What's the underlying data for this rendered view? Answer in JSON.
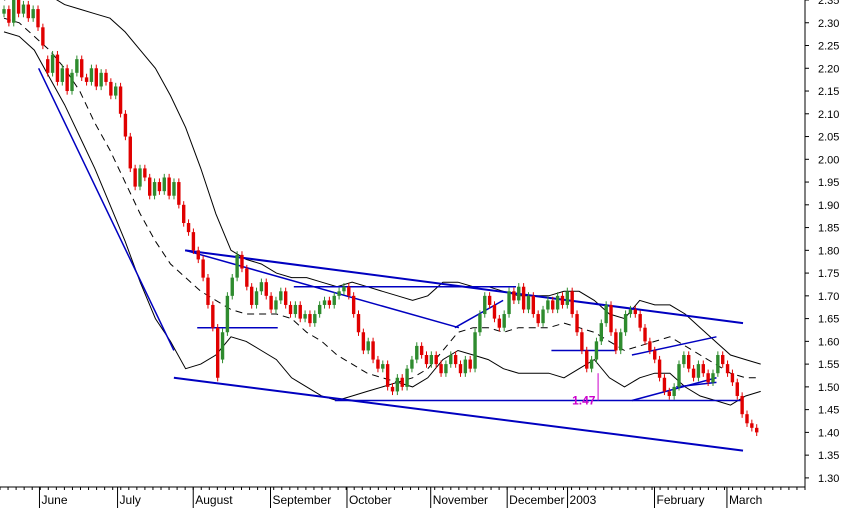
{
  "chart_data": {
    "type": "candlestick",
    "y_axis": {
      "ylim": [
        1.28,
        2.35
      ],
      "ticks": [
        "1.30",
        "1.35",
        "1.40",
        "1.45",
        "1.50",
        "1.55",
        "1.60",
        "1.65",
        "1.70",
        "1.75",
        "1.80",
        "1.85",
        "1.90",
        "1.95",
        "2.00",
        "2.05",
        "2.10",
        "2.15",
        "2.20",
        "2.25",
        "2.30",
        "2.35"
      ]
    },
    "x_axis": {
      "xlim": [
        0,
        100
      ],
      "labels": [
        {
          "text": "June",
          "x": 5.4
        },
        {
          "text": "July",
          "x": 15.1
        },
        {
          "text": "August",
          "x": 24.5
        },
        {
          "text": "September",
          "x": 34.1
        },
        {
          "text": "October",
          "x": 43.6
        },
        {
          "text": "November",
          "x": 54.0
        },
        {
          "text": "December",
          "x": 63.5
        },
        {
          "text": "2003",
          "x": 71.0
        },
        {
          "text": "February",
          "x": 81.8
        },
        {
          "text": "March",
          "x": 90.8
        }
      ]
    },
    "grid": false,
    "colors": {
      "up": "#2e8b2e",
      "down": "#e00000",
      "trendline": "#0000c0",
      "bands": "#000000",
      "annotation": "#cc00cc",
      "frame": "#000000"
    },
    "prices": [
      [
        2.32,
        2.33
      ],
      [
        2.33,
        2.3
      ],
      [
        2.3,
        2.35
      ],
      [
        2.35,
        2.32
      ],
      [
        2.32,
        2.34
      ],
      [
        2.34,
        2.31
      ],
      [
        2.31,
        2.33
      ],
      [
        2.33,
        2.29
      ],
      [
        2.29,
        2.25
      ],
      [
        2.22,
        2.19
      ],
      [
        2.19,
        2.23
      ],
      [
        2.23,
        2.17
      ],
      [
        2.17,
        2.2
      ],
      [
        2.2,
        2.15
      ],
      [
        2.15,
        2.19
      ],
      [
        2.19,
        2.22
      ],
      [
        2.22,
        2.18
      ],
      [
        2.18,
        2.17
      ],
      [
        2.17,
        2.2
      ],
      [
        2.2,
        2.16
      ],
      [
        2.16,
        2.19
      ],
      [
        2.19,
        2.17
      ],
      [
        2.17,
        2.14
      ],
      [
        2.14,
        2.16
      ],
      [
        2.16,
        2.1
      ],
      [
        2.1,
        2.05
      ],
      [
        2.05,
        1.98
      ],
      [
        1.98,
        1.94
      ],
      [
        1.94,
        1.98
      ],
      [
        1.98,
        1.96
      ],
      [
        1.96,
        1.92
      ],
      [
        1.92,
        1.95
      ],
      [
        1.95,
        1.93
      ],
      [
        1.93,
        1.96
      ],
      [
        1.96,
        1.92
      ],
      [
        1.92,
        1.95
      ],
      [
        1.95,
        1.9
      ],
      [
        1.9,
        1.86
      ],
      [
        1.86,
        1.84
      ],
      [
        1.84,
        1.8
      ],
      [
        1.8,
        1.78
      ],
      [
        1.78,
        1.74
      ],
      [
        1.74,
        1.68
      ],
      [
        1.68,
        1.63
      ],
      [
        1.63,
        1.52
      ],
      [
        1.56,
        1.62
      ],
      [
        1.62,
        1.7
      ],
      [
        1.7,
        1.74
      ],
      [
        1.74,
        1.79
      ],
      [
        1.79,
        1.76
      ],
      [
        1.76,
        1.72
      ],
      [
        1.72,
        1.68
      ],
      [
        1.68,
        1.71
      ],
      [
        1.71,
        1.73
      ],
      [
        1.73,
        1.7
      ],
      [
        1.7,
        1.67
      ],
      [
        1.67,
        1.69
      ],
      [
        1.69,
        1.71
      ],
      [
        1.71,
        1.68
      ],
      [
        1.68,
        1.66
      ],
      [
        1.66,
        1.68
      ],
      [
        1.68,
        1.65
      ],
      [
        1.65,
        1.66
      ],
      [
        1.66,
        1.64
      ],
      [
        1.64,
        1.66
      ],
      [
        1.66,
        1.68
      ],
      [
        1.68,
        1.69
      ],
      [
        1.69,
        1.68
      ],
      [
        1.68,
        1.7
      ],
      [
        1.7,
        1.71
      ],
      [
        1.71,
        1.72
      ],
      [
        1.72,
        1.7
      ],
      [
        1.7,
        1.66
      ],
      [
        1.66,
        1.62
      ],
      [
        1.62,
        1.58
      ],
      [
        1.58,
        1.6
      ],
      [
        1.6,
        1.56
      ],
      [
        1.56,
        1.54
      ],
      [
        1.54,
        1.55
      ],
      [
        1.55,
        1.5
      ],
      [
        1.5,
        1.49
      ],
      [
        1.49,
        1.52
      ],
      [
        1.52,
        1.5
      ],
      [
        1.5,
        1.54
      ],
      [
        1.54,
        1.56
      ],
      [
        1.56,
        1.59
      ],
      [
        1.59,
        1.57
      ],
      [
        1.57,
        1.55
      ],
      [
        1.55,
        1.57
      ],
      [
        1.57,
        1.55
      ],
      [
        1.55,
        1.53
      ],
      [
        1.53,
        1.55
      ],
      [
        1.55,
        1.57
      ],
      [
        1.57,
        1.55
      ],
      [
        1.55,
        1.53
      ],
      [
        1.53,
        1.56
      ],
      [
        1.56,
        1.54
      ],
      [
        1.54,
        1.62
      ],
      [
        1.62,
        1.66
      ],
      [
        1.66,
        1.7
      ],
      [
        1.7,
        1.68
      ],
      [
        1.68,
        1.65
      ],
      [
        1.65,
        1.63
      ],
      [
        1.63,
        1.66
      ],
      [
        1.66,
        1.71
      ],
      [
        1.71,
        1.69
      ],
      [
        1.69,
        1.72
      ],
      [
        1.72,
        1.67
      ],
      [
        1.67,
        1.7
      ],
      [
        1.7,
        1.66
      ],
      [
        1.66,
        1.64
      ],
      [
        1.64,
        1.67
      ],
      [
        1.67,
        1.69
      ],
      [
        1.69,
        1.67
      ],
      [
        1.67,
        1.7
      ],
      [
        1.7,
        1.68
      ],
      [
        1.68,
        1.71
      ],
      [
        1.71,
        1.66
      ],
      [
        1.66,
        1.62
      ],
      [
        1.62,
        1.58
      ],
      [
        1.58,
        1.54
      ],
      [
        1.54,
        1.56
      ],
      [
        1.56,
        1.6
      ],
      [
        1.6,
        1.64
      ],
      [
        1.64,
        1.68
      ],
      [
        1.68,
        1.62
      ],
      [
        1.62,
        1.58
      ],
      [
        1.58,
        1.62
      ],
      [
        1.62,
        1.66
      ],
      [
        1.66,
        1.67
      ],
      [
        1.67,
        1.66
      ],
      [
        1.66,
        1.63
      ],
      [
        1.63,
        1.6
      ],
      [
        1.6,
        1.58
      ],
      [
        1.58,
        1.56
      ],
      [
        1.56,
        1.52
      ],
      [
        1.52,
        1.49
      ],
      [
        1.49,
        1.48
      ],
      [
        1.48,
        1.5
      ],
      [
        1.5,
        1.55
      ],
      [
        1.55,
        1.57
      ],
      [
        1.57,
        1.54
      ],
      [
        1.54,
        1.52
      ],
      [
        1.52,
        1.55
      ],
      [
        1.55,
        1.53
      ],
      [
        1.53,
        1.51
      ],
      [
        1.51,
        1.53
      ],
      [
        1.53,
        1.57
      ],
      [
        1.57,
        1.55
      ],
      [
        1.55,
        1.53
      ],
      [
        1.53,
        1.51
      ],
      [
        1.51,
        1.48
      ],
      [
        1.48,
        1.44
      ],
      [
        1.44,
        1.42
      ],
      [
        1.42,
        1.41
      ],
      [
        1.41,
        1.4
      ]
    ],
    "upper_band": [
      2.35,
      2.36,
      2.37,
      2.36,
      2.34,
      2.33,
      2.32,
      2.31,
      2.28,
      2.24,
      2.2,
      2.14,
      2.07,
      1.98,
      1.88,
      1.8,
      1.78,
      1.77,
      1.75,
      1.74,
      1.74,
      1.73,
      1.72,
      1.73,
      1.72,
      1.71,
      1.7,
      1.69,
      1.7,
      1.73,
      1.73,
      1.72,
      1.72,
      1.71,
      1.7,
      1.7,
      1.7,
      1.71,
      1.71,
      1.69,
      1.66,
      1.65,
      1.69,
      1.68,
      1.68,
      1.66,
      1.63,
      1.6,
      1.57,
      1.56,
      1.55
    ],
    "lower_band": [
      2.28,
      2.27,
      2.24,
      2.18,
      2.12,
      2.05,
      1.98,
      1.9,
      1.82,
      1.73,
      1.65,
      1.6,
      1.54,
      1.55,
      1.57,
      1.61,
      1.6,
      1.58,
      1.56,
      1.52,
      1.5,
      1.48,
      1.47,
      1.48,
      1.49,
      1.5,
      1.51,
      1.5,
      1.52,
      1.56,
      1.58,
      1.57,
      1.56,
      1.54,
      1.53,
      1.53,
      1.53,
      1.52,
      1.54,
      1.56,
      1.52,
      1.5,
      1.52,
      1.53,
      1.53,
      1.5,
      1.48,
      1.47,
      1.46,
      1.48,
      1.49
    ],
    "moving_average": [
      2.31,
      2.3,
      2.27,
      2.24,
      2.2,
      2.15,
      2.08,
      2.02,
      1.95,
      1.88,
      1.82,
      1.77,
      1.74,
      1.71,
      1.69,
      1.67,
      1.66,
      1.66,
      1.66,
      1.65,
      1.62,
      1.6,
      1.57,
      1.55,
      1.53,
      1.52,
      1.51,
      1.52,
      1.54,
      1.58,
      1.62,
      1.63,
      1.63,
      1.62,
      1.63,
      1.63,
      1.63,
      1.64,
      1.63,
      1.62,
      1.6,
      1.58,
      1.59,
      1.6,
      1.61,
      1.59,
      1.57,
      1.55,
      1.53,
      1.52,
      1.52
    ],
    "trendlines": [
      {
        "x": [
          21.6,
          92.3
        ],
        "y": [
          1.52,
          1.36
        ]
      },
      {
        "x": [
          23.0,
          92.3
        ],
        "y": [
          1.8,
          1.64
        ]
      },
      {
        "x": [
          4.8,
          21.6
        ],
        "y": [
          2.2,
          1.58
        ]
      },
      {
        "x": [
          23.0,
          57.0
        ],
        "y": [
          1.8,
          1.63
        ]
      },
      {
        "x": [
          41.6,
          92.3
        ],
        "y": [
          1.47,
          1.47
        ]
      },
      {
        "x": [
          36.5,
          64.1
        ],
        "y": [
          1.72,
          1.72
        ]
      },
      {
        "x": [
          24.5,
          34.5
        ],
        "y": [
          1.63,
          1.63
        ]
      },
      {
        "x": [
          68.5,
          76.5
        ],
        "y": [
          1.58,
          1.58
        ]
      },
      {
        "x": [
          78.5,
          89.0
        ],
        "y": [
          1.47,
          1.52
        ]
      },
      {
        "x": [
          78.5,
          89.0
        ],
        "y": [
          1.57,
          1.61
        ]
      },
      {
        "x": [
          84.0,
          89.0
        ],
        "y": [
          1.5,
          1.51
        ]
      },
      {
        "x": [
          56.5,
          62.5
        ],
        "y": [
          1.63,
          1.69
        ]
      }
    ],
    "annotation": {
      "text": "1.47",
      "x": 73.8,
      "y": 1.47
    }
  }
}
